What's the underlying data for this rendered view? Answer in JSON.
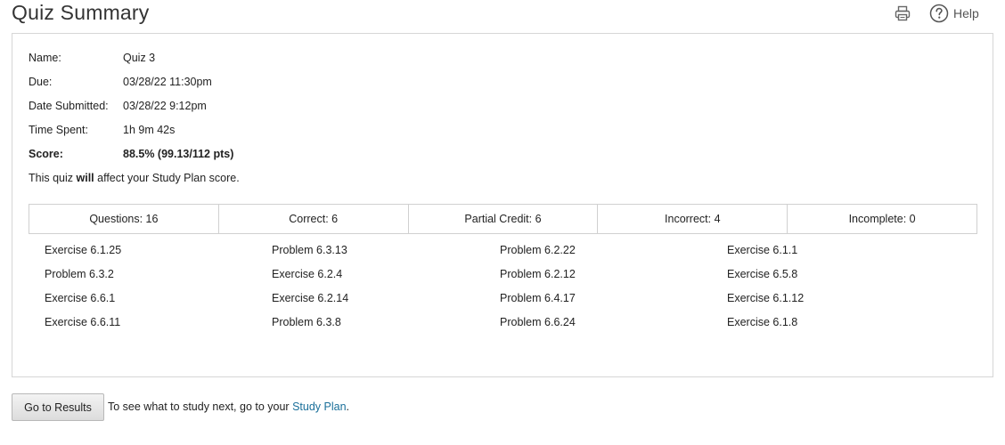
{
  "header": {
    "title": "Quiz Summary",
    "print_icon": "printer-icon",
    "help_icon": "question-circle-icon",
    "help_label": "Help"
  },
  "summary": {
    "name_label": "Name:",
    "name_value": "Quiz 3",
    "due_label": "Due:",
    "due_value": "03/28/22 11:30pm",
    "submitted_label": "Date Submitted:",
    "submitted_value": "03/28/22 9:12pm",
    "time_label": "Time Spent:",
    "time_value": "1h 9m 42s",
    "score_label": "Score:",
    "score_value": "88.5% (99.13/112 pts)",
    "note_prefix": "This quiz ",
    "note_emphasis": "will",
    "note_suffix": " affect your Study Plan score."
  },
  "stats": [
    "Questions: 16",
    "Correct: 6",
    "Partial Credit: 6",
    "Incorrect: 4",
    "Incomplete: 0"
  ],
  "questions": {
    "col1": [
      "Exercise 6.1.25",
      "Problem 6.3.2",
      "Exercise 6.6.1",
      "Exercise 6.6.11"
    ],
    "col2": [
      "Problem 6.3.13",
      "Exercise 6.2.4",
      "Exercise 6.2.14",
      "Problem 6.3.8"
    ],
    "col3": [
      "Problem 6.2.22",
      "Problem 6.2.12",
      "Problem 6.4.17",
      "Problem 6.6.24"
    ],
    "col4": [
      "Exercise 6.1.1",
      "Exercise 6.5.8",
      "Exercise 6.1.12",
      "Exercise 6.1.8"
    ]
  },
  "footer": {
    "results_button": "Go to Results",
    "text_prefix": "To see what to study next, go to your ",
    "link_label": "Study Plan",
    "text_suffix": "."
  },
  "colors": {
    "link": "#1a6f9a",
    "border": "#d6d6d6"
  }
}
